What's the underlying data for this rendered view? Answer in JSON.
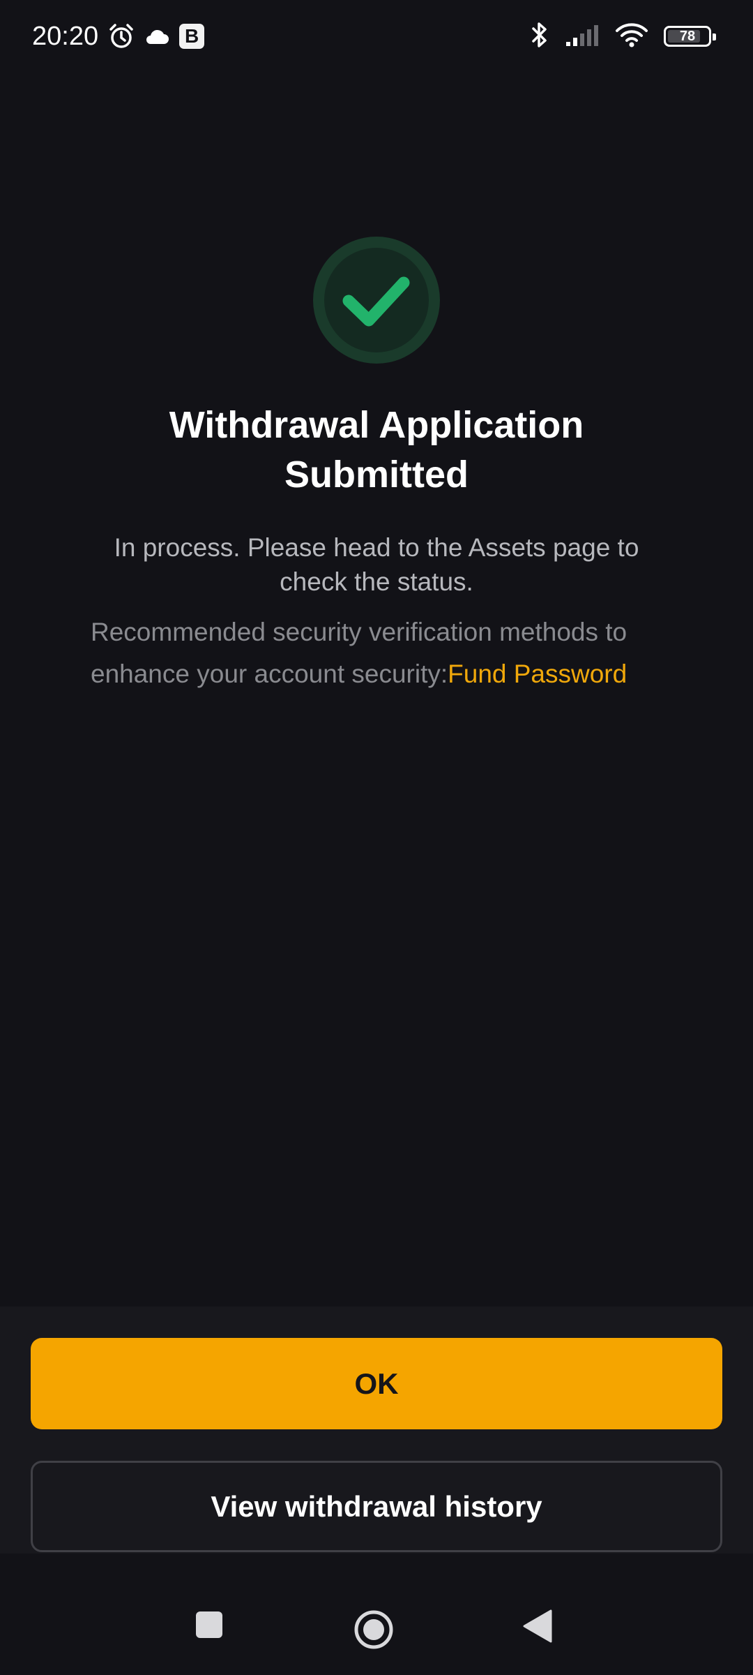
{
  "status_bar": {
    "time": "20:20",
    "battery_level": "78",
    "icons": [
      "alarm-icon",
      "cloud-icon",
      "b-app-icon",
      "bluetooth-icon",
      "signal-icon",
      "wifi-icon",
      "battery-icon"
    ],
    "b_badge": "B"
  },
  "result": {
    "icon": "check-circle-icon",
    "title": "Withdrawal Application Submitted",
    "description": "In process. Please head to the Assets page to check the status.",
    "recommend_text": "Recommended security verification methods to enhance your account security:",
    "fund_password_link": "Fund Password"
  },
  "actions": {
    "ok_label": "OK",
    "history_label": "View withdrawal history"
  },
  "nav": {
    "icons": [
      "recent-apps-icon",
      "home-icon",
      "back-icon"
    ]
  },
  "colors": {
    "background": "#121217",
    "accent": "#f5a500",
    "link": "#f0a80b",
    "success": "#22b36b"
  }
}
